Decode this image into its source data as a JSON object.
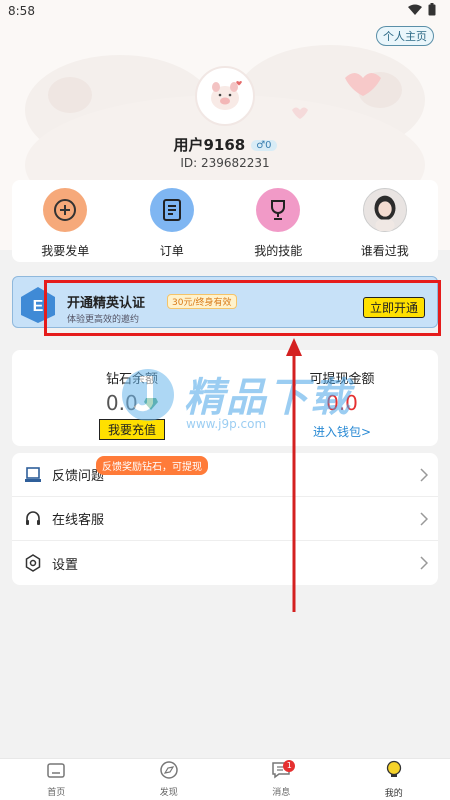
{
  "status_bar": {
    "time": "8:58"
  },
  "header": {
    "homepage_label": "个人主页"
  },
  "profile": {
    "username": "用户9168",
    "gender_badge": "♂0",
    "user_id": "ID: 239682231"
  },
  "quick_menu": [
    {
      "label": "我要发单",
      "icon": "plus-circle-icon",
      "color": "#f6a97a"
    },
    {
      "label": "订单",
      "icon": "document-icon",
      "color": "#7fb6f2"
    },
    {
      "label": "我的技能",
      "icon": "trophy-icon",
      "color": "#f19ac7"
    },
    {
      "label": "谁看过我",
      "icon": "visitor-avatar-icon",
      "color": "#cccccc"
    }
  ],
  "elite": {
    "title": "开通精英认证",
    "badge": "30元/终身有效",
    "subtitle": "体验更高效的邀约",
    "button": "立即开通"
  },
  "wallet": {
    "diamond_label": "钻石余额",
    "diamond_value": "0.0",
    "recharge": "我要充值",
    "cash_label": "可提现金额",
    "cash_value": "0.0",
    "wallet_link": "进入钱包>"
  },
  "watermark": {
    "text": "精品下载",
    "url": "www.j9p.com"
  },
  "list": [
    {
      "label": "反馈问题",
      "icon": "feedback-icon"
    },
    {
      "label": "在线客服",
      "icon": "headset-icon"
    },
    {
      "label": "设置",
      "icon": "gear-icon"
    }
  ],
  "tooltip": "反馈奖励钻石，可提现",
  "tabs": [
    {
      "label": "首页",
      "icon": "home-icon"
    },
    {
      "label": "发现",
      "icon": "discover-icon"
    },
    {
      "label": "消息",
      "icon": "message-icon",
      "badge": "1"
    },
    {
      "label": "我的",
      "icon": "bulb-icon",
      "active": true
    }
  ],
  "colors": {
    "accent_yellow": "#ffe000",
    "banner_blue": "#c7e1f8",
    "highlight_red": "#e51c1c",
    "link_blue": "#2a8ad4"
  }
}
